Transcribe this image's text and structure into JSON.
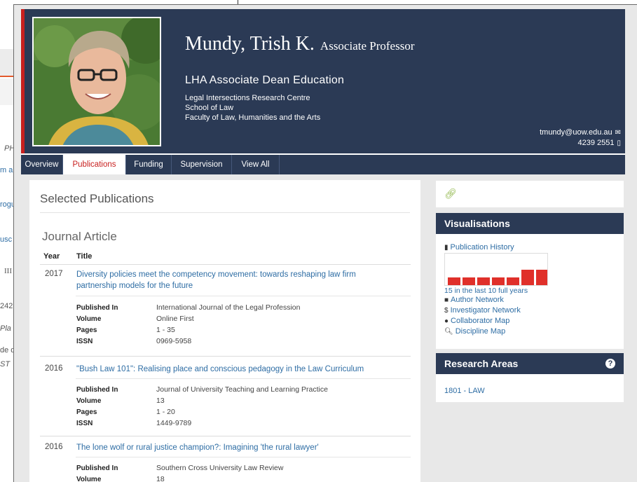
{
  "background_page": {
    "fragments": [
      "PH",
      "m a",
      "rogu",
      "usc",
      "III",
      "242",
      "Pla",
      "de d",
      "ST"
    ]
  },
  "profile": {
    "name": "Mundy, Trish K.",
    "rank": "Associate Professor",
    "position": "LHA Associate Dean Education",
    "units": [
      "Legal Intersections Research Centre",
      "School of Law",
      "Faculty of Law, Humanities and the Arts"
    ],
    "email": "tmundy@uow.edu.au",
    "phone": "4239 2551",
    "email_icon": "envelope-icon",
    "phone_icon": "phone-icon"
  },
  "nav": {
    "tabs": [
      "Overview",
      "Publications",
      "Funding",
      "Supervision",
      "View All"
    ],
    "active": "Publications"
  },
  "main": {
    "section_title": "Selected Publications",
    "subsection_title": "Journal Article",
    "col_year": "Year",
    "col_title": "Title",
    "labels": {
      "published_in": "Published In",
      "volume": "Volume",
      "pages": "Pages",
      "issn": "ISSN"
    },
    "publications": [
      {
        "year": "2017",
        "title": "Diversity policies meet the competency movement: towards reshaping law firm partnership models for the future",
        "published_in": "International Journal of the Legal Profession",
        "volume": "Online First",
        "pages": "1 - 35",
        "issn": "0969-5958"
      },
      {
        "year": "2016",
        "title": "\"Bush Law 101\": Realising place and conscious pedagogy in the Law Curriculum",
        "published_in": "Journal of University Teaching and Learning Practice",
        "volume": "13",
        "pages": "1 - 20",
        "issn": "1449-9789"
      },
      {
        "year": "2016",
        "title": "The lone wolf or rural justice champion?: Imagining 'the rural lawyer'",
        "published_in": "Southern Cross University Law Review",
        "volume": "18"
      }
    ]
  },
  "sidebar": {
    "link_icon": "link-icon",
    "visualisations": {
      "title": "Visualisations",
      "history_label": "Publication History",
      "count_text": "15 in the last 10 full years",
      "links": [
        "Author Network",
        "Investigator Network",
        "Collaborator Map",
        "Discipline Map"
      ],
      "bar_color": "#e0302a"
    },
    "research_areas": {
      "title": "Research Areas",
      "help": "?",
      "items": [
        "1801 - LAW"
      ]
    }
  },
  "colors": {
    "header_bg": "#2b3a55",
    "accent_red": "#c8201f",
    "link_blue": "#2e6da4"
  }
}
